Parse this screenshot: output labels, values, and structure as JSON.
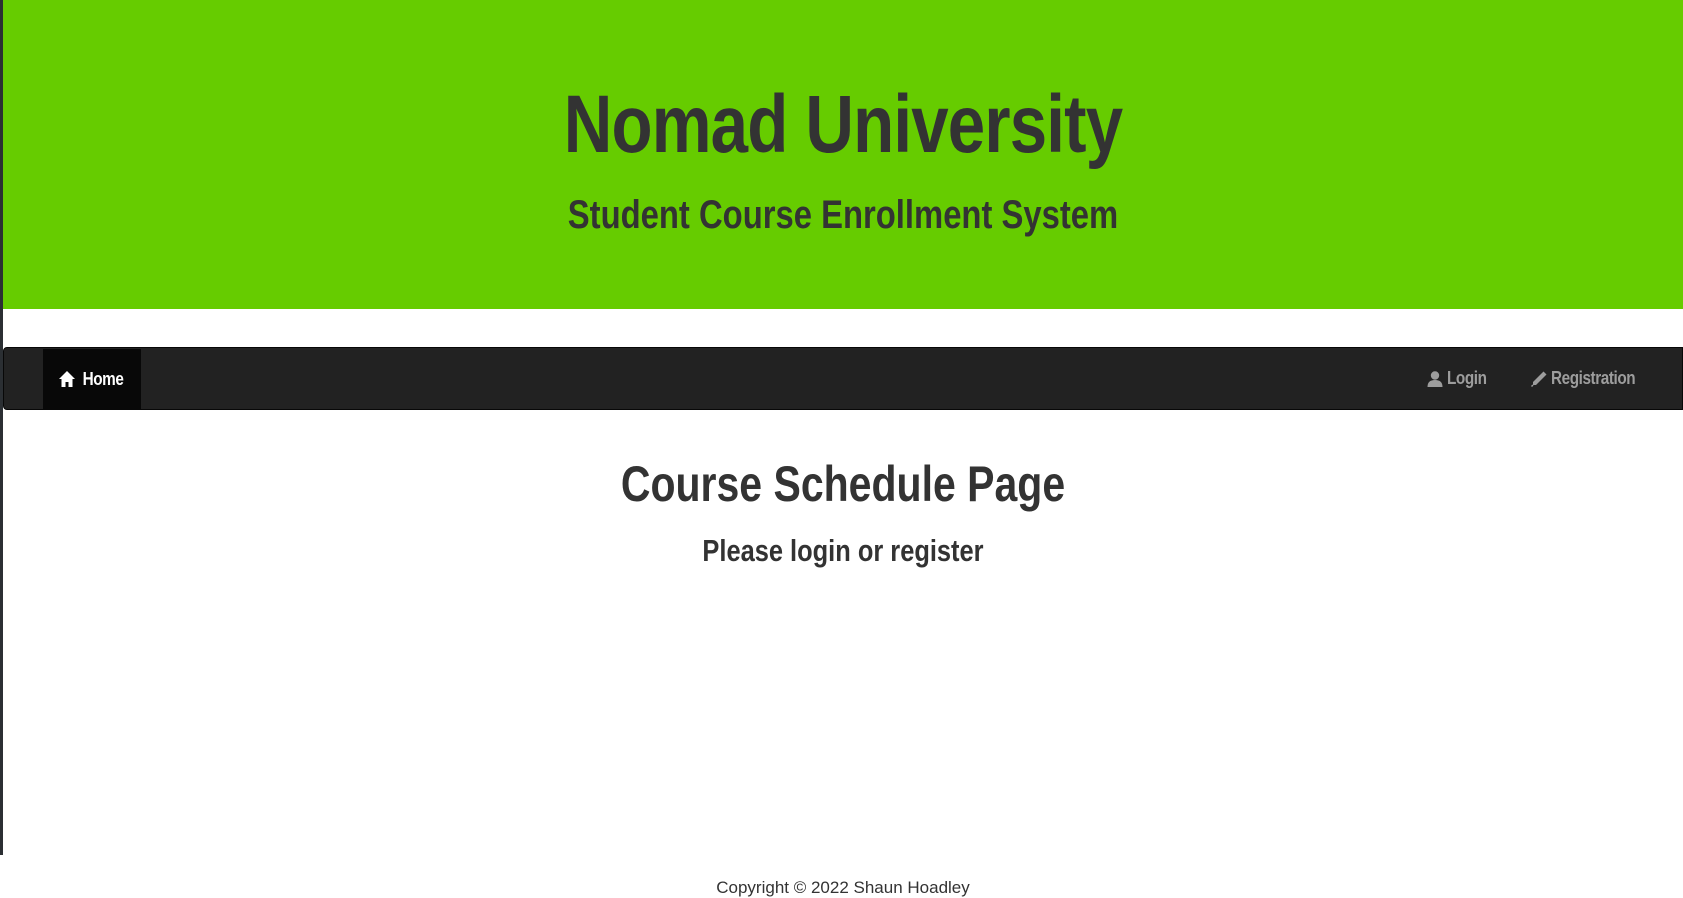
{
  "header": {
    "title": "Nomad University",
    "subtitle": "Student Course Enrollment System"
  },
  "navbar": {
    "home": {
      "label": "Home",
      "icon": "home-icon"
    },
    "login": {
      "label": "Login",
      "icon": "user-icon"
    },
    "registration": {
      "label": "Registration",
      "icon": "pencil-icon"
    }
  },
  "main": {
    "title": "Course Schedule Page",
    "message": "Please login or register"
  },
  "footer": {
    "copyright": "Copyright © 2022 Shaun Hoadley"
  },
  "colors": {
    "banner": "#66cc00",
    "navbar": "#222222",
    "navbar_active": "#080808",
    "text_dark": "#333333",
    "nav_link": "#9d9d9d"
  }
}
